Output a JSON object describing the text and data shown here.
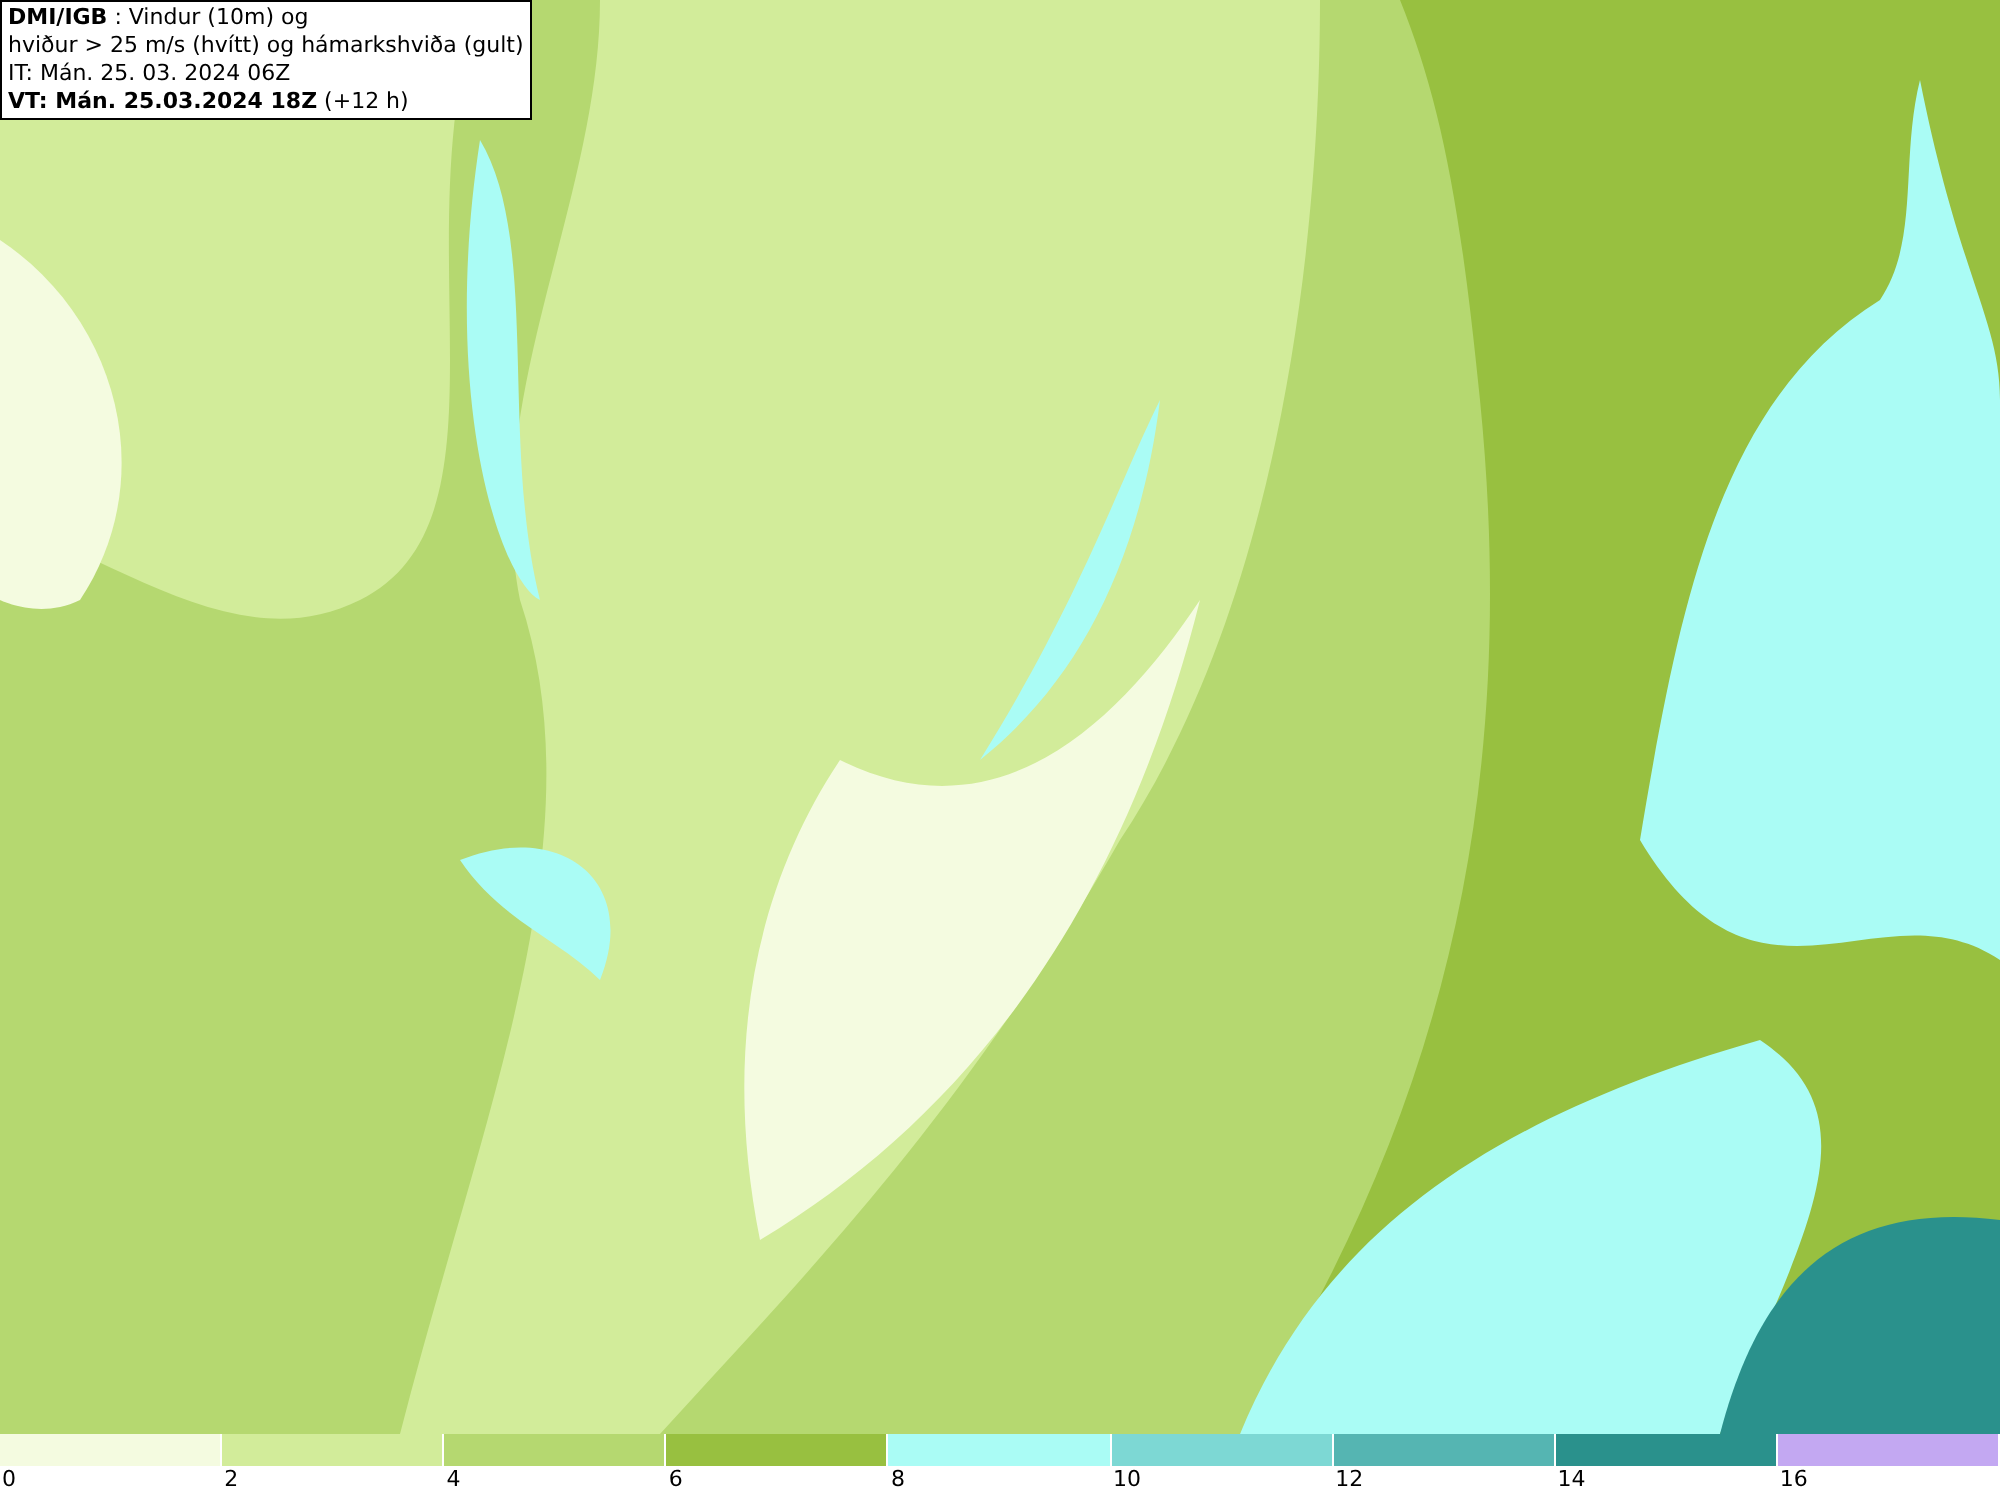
{
  "header": {
    "lines": [
      "**DMI/IGB** : Vindur (10m) og",
      "hviður > 25 m/s (hvítt) og hámarkshviða (gult)",
      "IT: Mán. 25. 03. 2024 06Z",
      "**VT: Mán. 25.03.2024 18Z** (+12 h)"
    ]
  },
  "legend": [
    {
      "color": "#f4fbe0",
      "label": "0"
    },
    {
      "color": "#d2ec9a",
      "label": "2"
    },
    {
      "color": "#b5d870",
      "label": "4"
    },
    {
      "color": "#98c040",
      "label": "6"
    },
    {
      "color": "#aafcf5",
      "label": "8"
    },
    {
      "color": "#7dd8d4",
      "label": "10"
    },
    {
      "color": "#55b5b2",
      "label": "12"
    },
    {
      "color": "#2a918c",
      "label": "14"
    },
    {
      "color": "#c3a8f2",
      "label": "16"
    }
  ]
}
